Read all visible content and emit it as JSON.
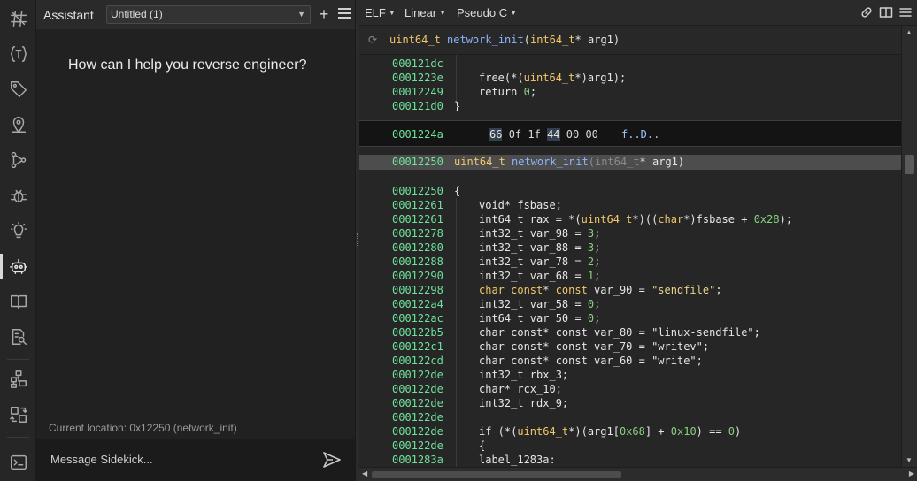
{
  "rail": {
    "items": [
      {
        "name": "logo-icon"
      },
      {
        "name": "types-icon"
      },
      {
        "name": "tags-icon"
      },
      {
        "name": "location-pin-icon"
      },
      {
        "name": "graph-icon"
      },
      {
        "name": "debugger-bug-icon"
      },
      {
        "name": "lightbulb-icon"
      },
      {
        "name": "assistant-robot-icon"
      },
      {
        "name": "book-icon"
      },
      {
        "name": "search-document-icon"
      },
      {
        "name": "hierarchy-icon"
      },
      {
        "name": "compare-icon"
      },
      {
        "name": "terminal-icon"
      }
    ]
  },
  "assistant": {
    "title": "Assistant",
    "conversation": "Untitled (1)",
    "prompt": "How can I help you reverse engineer?",
    "current_location": "Current location: 0x12250 (network_init)",
    "input_placeholder": "Message Sidekick..."
  },
  "toolbar": {
    "view_type": "ELF",
    "layout": "Linear",
    "language": "Pseudo C"
  },
  "signature": {
    "ret_type": "uint64_t",
    "name": "network_init",
    "params_open": "(",
    "param_type": "int64_t",
    "param_rest": "* arg1)"
  },
  "code": {
    "prev_lines": [
      {
        "addr": "000121dc",
        "indent": 1,
        "tokens": []
      },
      {
        "addr": "0001223e",
        "indent": 1,
        "tokens": [
          [
            "pl",
            "free(*("
          ],
          [
            "ty",
            "uint64_t"
          ],
          [
            "pl",
            "*)arg1);"
          ]
        ]
      },
      {
        "addr": "00012249",
        "indent": 1,
        "tokens": [
          [
            "pl",
            "return "
          ],
          [
            "num",
            "0"
          ],
          [
            "pl",
            ";"
          ]
        ]
      },
      {
        "addr": "000121d0",
        "indent": 0,
        "tokens": [
          [
            "pl",
            "}"
          ]
        ]
      }
    ],
    "hex": {
      "addr": "0001224a",
      "bytes": [
        "66",
        "0f",
        "1f",
        "44",
        "00",
        "00"
      ],
      "ascii": "f..D.."
    },
    "func_header": {
      "addr": "00012250",
      "ret_type": "uint64_t",
      "name": "network_init",
      "param_type": "int64_t",
      "param_rest": "* arg1)"
    },
    "body": [
      {
        "addr": "00012250",
        "indent": 0,
        "tokens": [
          [
            "pl",
            "{"
          ]
        ]
      },
      {
        "addr": "00012261",
        "indent": 1,
        "tokens": [
          [
            "pl",
            "void* fsbase;"
          ]
        ]
      },
      {
        "addr": "00012261",
        "indent": 1,
        "tokens": [
          [
            "pl",
            "int64_t rax = *("
          ],
          [
            "ty",
            "uint64_t"
          ],
          [
            "pl",
            "*)(("
          ],
          [
            "ty",
            "char"
          ],
          [
            "pl",
            "*)fsbase + "
          ],
          [
            "num",
            "0x28"
          ],
          [
            "pl",
            ");"
          ]
        ]
      },
      {
        "addr": "00012278",
        "indent": 1,
        "tokens": [
          [
            "pl",
            "int32_t var_98 = "
          ],
          [
            "num",
            "3"
          ],
          [
            "pl",
            ";"
          ]
        ]
      },
      {
        "addr": "00012280",
        "indent": 1,
        "tokens": [
          [
            "pl",
            "int32_t var_88 = "
          ],
          [
            "num",
            "3"
          ],
          [
            "pl",
            ";"
          ]
        ]
      },
      {
        "addr": "00012288",
        "indent": 1,
        "tokens": [
          [
            "pl",
            "int32_t var_78 = "
          ],
          [
            "num",
            "2"
          ],
          [
            "pl",
            ";"
          ]
        ]
      },
      {
        "addr": "00012290",
        "indent": 1,
        "tokens": [
          [
            "pl",
            "int32_t var_68 = "
          ],
          [
            "num",
            "1"
          ],
          [
            "pl",
            ";"
          ]
        ]
      },
      {
        "addr": "00012298",
        "indent": 1,
        "tokens": [
          [
            "ty",
            "char const"
          ],
          [
            "pl",
            "* "
          ],
          [
            "ty",
            "const"
          ],
          [
            "pl",
            " var_90 = "
          ],
          [
            "str",
            "\"sendfile\""
          ],
          [
            "pl",
            ";"
          ]
        ]
      },
      {
        "addr": "000122a4",
        "indent": 1,
        "tokens": [
          [
            "pl",
            "int32_t var_58 = "
          ],
          [
            "num",
            "0"
          ],
          [
            "pl",
            ";"
          ]
        ]
      },
      {
        "addr": "000122ac",
        "indent": 1,
        "tokens": [
          [
            "pl",
            "int64_t var_50 = "
          ],
          [
            "num",
            "0"
          ],
          [
            "pl",
            ";"
          ]
        ]
      },
      {
        "addr": "000122b5",
        "indent": 1,
        "tokens": [
          [
            "pl",
            "char const* const var_80 = \"linux-sendfile\";"
          ]
        ]
      },
      {
        "addr": "000122c1",
        "indent": 1,
        "tokens": [
          [
            "pl",
            "char const* const var_70 = \"writev\";"
          ]
        ]
      },
      {
        "addr": "000122cd",
        "indent": 1,
        "tokens": [
          [
            "pl",
            "char const* const var_60 = \"write\";"
          ]
        ]
      },
      {
        "addr": "000122de",
        "indent": 1,
        "tokens": [
          [
            "pl",
            "int32_t rbx_3;"
          ]
        ]
      },
      {
        "addr": "000122de",
        "indent": 1,
        "tokens": [
          [
            "pl",
            "char* rcx_10;"
          ]
        ]
      },
      {
        "addr": "000122de",
        "indent": 1,
        "tokens": [
          [
            "pl",
            "int32_t rdx_9;"
          ]
        ]
      },
      {
        "addr": "000122de",
        "indent": 1,
        "tokens": []
      },
      {
        "addr": "000122de",
        "indent": 1,
        "tokens": [
          [
            "pl",
            "if (*("
          ],
          [
            "ty",
            "uint64_t"
          ],
          [
            "pl",
            "*)(arg1["
          ],
          [
            "num",
            "0x68"
          ],
          [
            "pl",
            "] + "
          ],
          [
            "num",
            "0x10"
          ],
          [
            "pl",
            ") == "
          ],
          [
            "num",
            "0"
          ],
          [
            "pl",
            ")"
          ]
        ]
      },
      {
        "addr": "000122de",
        "indent": 1,
        "tokens": [
          [
            "pl",
            "{"
          ]
        ]
      },
      {
        "addr": "0001283a",
        "indent": 1,
        "tokens": [
          [
            "pl",
            "label_1283a:"
          ]
        ]
      }
    ]
  }
}
